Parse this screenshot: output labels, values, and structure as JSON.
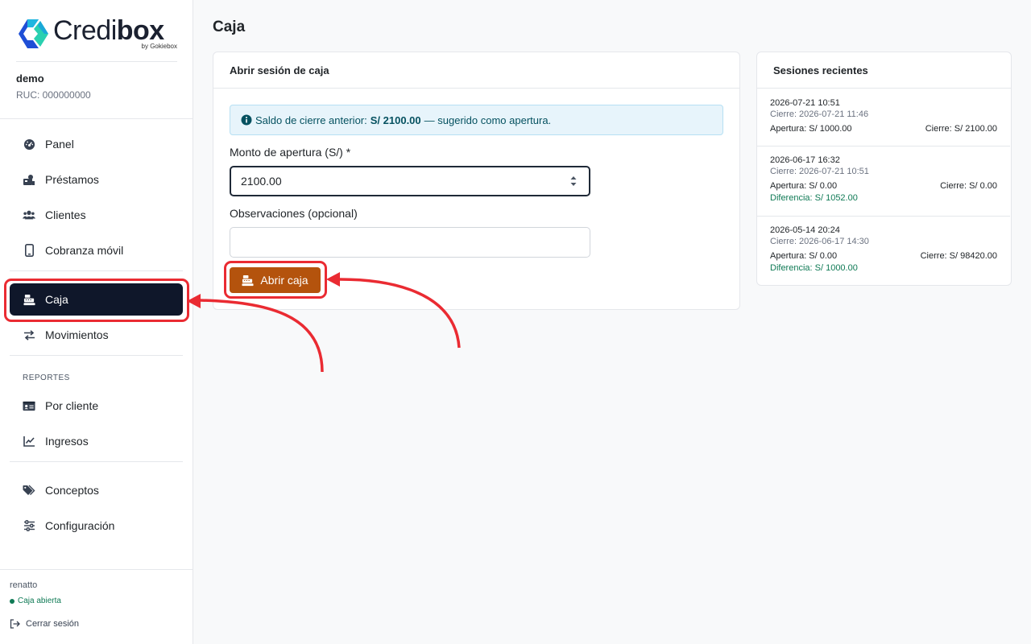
{
  "brand": {
    "name_regular": "Credi",
    "name_bold": "box",
    "subtitle": "by Gokiebox"
  },
  "tenant": {
    "name": "demo",
    "ruc": "RUC: 000000000"
  },
  "nav": {
    "main": [
      {
        "label": "Panel",
        "icon": "dashboard-icon"
      },
      {
        "label": "Préstamos",
        "icon": "loans-icon"
      },
      {
        "label": "Clientes",
        "icon": "users-icon"
      },
      {
        "label": "Cobranza móvil",
        "icon": "mobile-icon"
      }
    ],
    "cash": [
      {
        "label": "Caja",
        "icon": "cash-register-icon",
        "active": true
      },
      {
        "label": "Movimientos",
        "icon": "transfer-icon"
      }
    ],
    "reports_label": "REPORTES",
    "reports": [
      {
        "label": "Por cliente",
        "icon": "id-card-icon"
      },
      {
        "label": "Ingresos",
        "icon": "chart-line-icon"
      }
    ],
    "settings": [
      {
        "label": "Conceptos",
        "icon": "tags-icon"
      },
      {
        "label": "Configuración",
        "icon": "sliders-icon"
      }
    ]
  },
  "footer": {
    "user": "renatto",
    "status": "Caja abierta",
    "logout": "Cerrar sesión"
  },
  "page": {
    "title": "Caja"
  },
  "open_session": {
    "header": "Abrir sesión de caja",
    "info_prefix": "Saldo de cierre anterior:",
    "info_amount": "S/ 2100.00",
    "info_suffix": "— sugerido como apertura.",
    "amount_label": "Monto de apertura (S/) *",
    "amount_value": "2100.00",
    "notes_label": "Observaciones (opcional)",
    "notes_value": "",
    "submit": "Abrir caja"
  },
  "recent": {
    "header": "Sesiones recientes",
    "sessions": [
      {
        "date": "2026-07-21 10:51",
        "close": "Cierre: 2026-07-21 11:46",
        "opening": "Apertura: S/ 1000.00",
        "closing": "Cierre: S/ 2100.00",
        "diff": ""
      },
      {
        "date": "2026-06-17 16:32",
        "close": "Cierre: 2026-07-21 10:51",
        "opening": "Apertura: S/ 0.00",
        "closing": "Cierre: S/ 0.00",
        "diff": "Diferencia: S/ 1052.00"
      },
      {
        "date": "2026-05-14 20:24",
        "close": "Cierre: 2026-06-17 14:30",
        "opening": "Apertura: S/ 0.00",
        "closing": "Cierre: S/ 98420.00",
        "diff": "Diferencia: S/ 1000.00"
      }
    ]
  },
  "colors": {
    "accent": "#b4530d",
    "active_nav": "#0f172a",
    "highlight": "#ea2b32",
    "success": "#0f7a55",
    "info_bg": "#e7f4fb"
  }
}
